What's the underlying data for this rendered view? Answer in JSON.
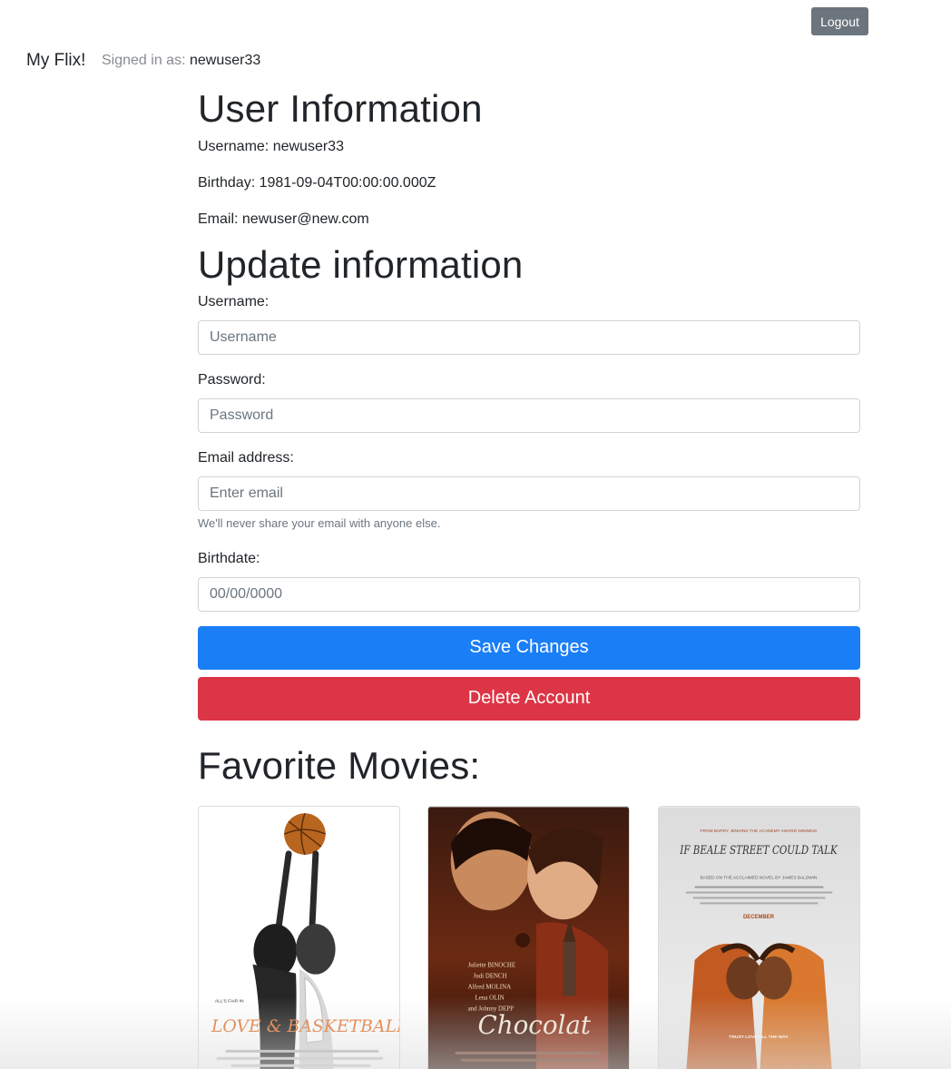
{
  "header": {
    "logout_label": "Logout",
    "brand": "My Flix!",
    "signed_in_prefix": "Signed in as:",
    "signed_in_user": "newuser33"
  },
  "user_info": {
    "title": "User Information",
    "username_line": "Username: newuser33",
    "birthday_line": "Birthday: 1981-09-04T00:00:00.000Z",
    "email_line": "Email: newuser@new.com"
  },
  "update_form": {
    "title": "Update information",
    "username_label": "Username:",
    "username_placeholder": "Username",
    "password_label": "Password:",
    "password_placeholder": "Password",
    "email_label": "Email address:",
    "email_placeholder": "Enter email",
    "email_help": "We'll never share your email with anyone else.",
    "birthdate_label": "Birthdate:",
    "birthdate_placeholder": "00/00/0000",
    "save_label": "Save Changes",
    "delete_label": "Delete Account"
  },
  "favorites": {
    "title": "Favorite Movies:",
    "movies": [
      {
        "poster_text": "LOVE & BASKETBALL",
        "tagline": "ALL'S FAIR IN"
      },
      {
        "poster_text": "Chocolat",
        "credits": [
          "Juliette BINOCHE",
          "Judi DENCH",
          "Alfred MOLINA",
          "Lena OLIN",
          "and Johnny DEPP"
        ]
      },
      {
        "poster_text": "IF BEALE STREET COULD TALK",
        "tagline": "TRUST LOVE ALL THE WAY",
        "month": "DECEMBER",
        "top_line": "FROM BARRY JENKINS THE ACADEMY AWARD WINNING",
        "sub_line": "BASED ON THE ACCLAIMED NOVEL BY JAMES BALDWIN"
      }
    ]
  },
  "colors": {
    "primary": "#1a7ef7",
    "danger": "#dc3545",
    "secondary": "#6c757d"
  }
}
